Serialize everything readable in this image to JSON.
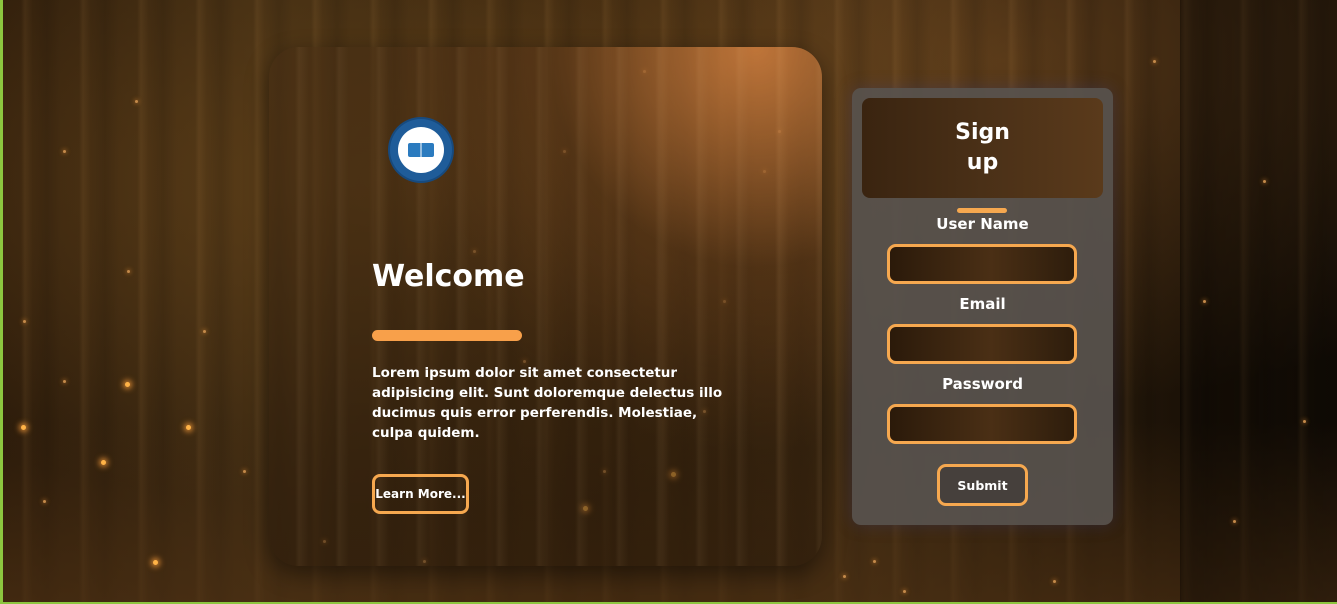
{
  "welcome": {
    "logo_icon": "academy-logo-icon",
    "title": "Welcome",
    "body": "Lorem ipsum dolor sit amet consectetur adipisicing elit. Sunt doloremque delectus illo ducimus quis error perferendis. Molestiae, culpa quidem.",
    "learn_more_label": "Learn More..."
  },
  "signup": {
    "title": "Sign up",
    "username_label": "User Name",
    "username_value": "",
    "email_label": "Email",
    "email_value": "",
    "password_label": "Password",
    "password_value": "",
    "submit_label": "Submit"
  },
  "colors": {
    "accent": "#f6a84f",
    "page_border": "#8cc63f",
    "panel_bg": "#58524e",
    "text": "#ffffff"
  }
}
